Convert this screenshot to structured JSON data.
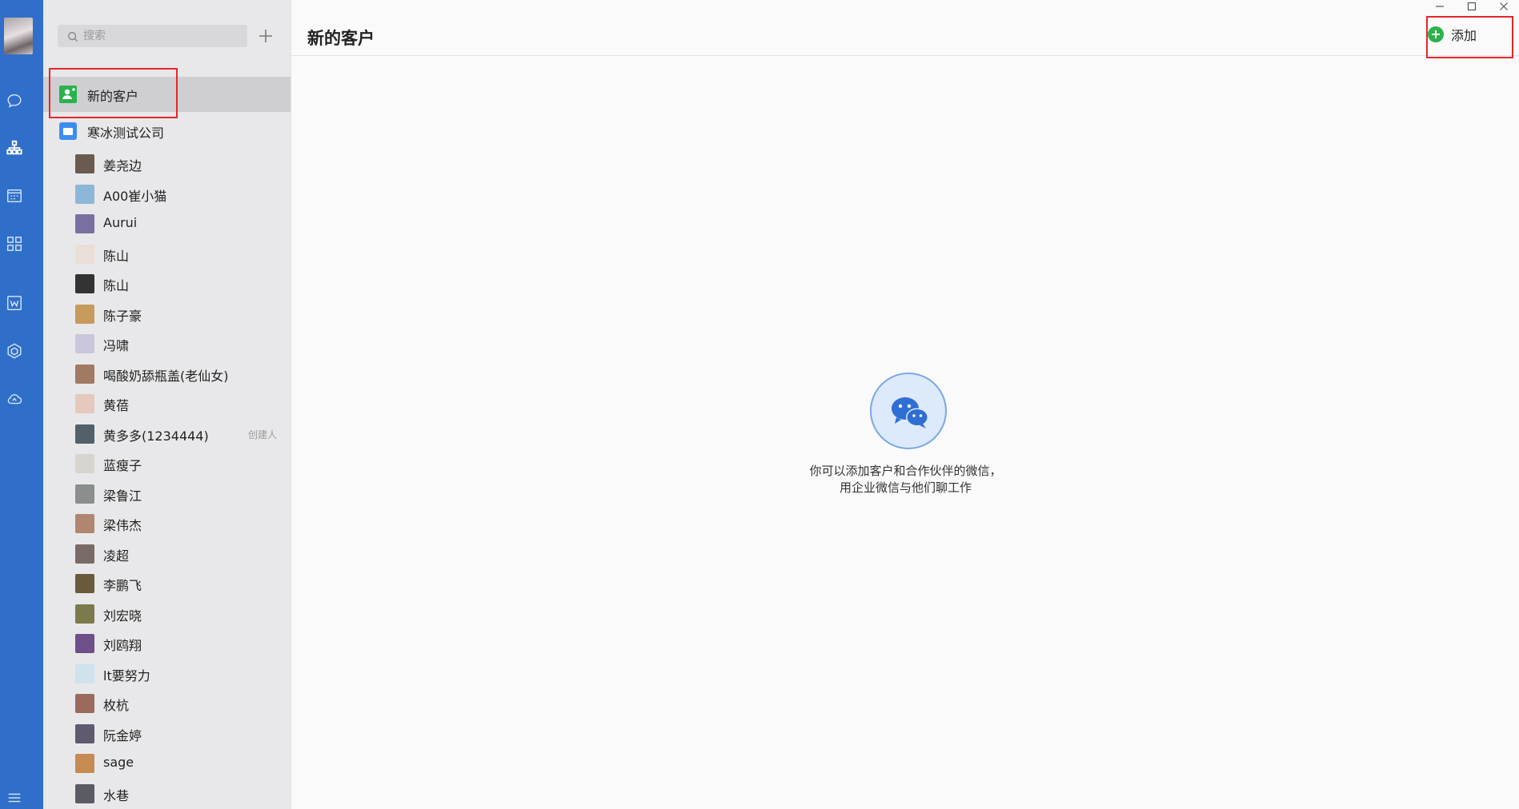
{
  "sidebar": {
    "nav": [
      "messages",
      "contacts",
      "calendar",
      "workbench",
      "documents",
      "apps",
      "cloud-drive",
      "menu"
    ],
    "active": "contacts"
  },
  "contacts_panel": {
    "search": {
      "placeholder": "搜索",
      "value": ""
    },
    "new_customer_label": "新的客户",
    "company_label": "寒冰测试公司",
    "members": [
      {
        "name": "姜尧边",
        "tag": ""
      },
      {
        "name": "A00崔小猫",
        "tag": ""
      },
      {
        "name": "Aurui",
        "tag": ""
      },
      {
        "name": "陈山",
        "tag": ""
      },
      {
        "name": "陈山",
        "tag": ""
      },
      {
        "name": "陈子豪",
        "tag": ""
      },
      {
        "name": "冯啸",
        "tag": ""
      },
      {
        "name": "喝酸奶舔瓶盖(老仙女)",
        "tag": ""
      },
      {
        "name": "黄蓓",
        "tag": ""
      },
      {
        "name": "黄多多(1234444)",
        "tag": "创建人"
      },
      {
        "name": "蓝瘦子",
        "tag": ""
      },
      {
        "name": "梁鲁江",
        "tag": ""
      },
      {
        "name": "梁伟杰",
        "tag": ""
      },
      {
        "name": "凌超",
        "tag": ""
      },
      {
        "name": "李鹏飞",
        "tag": ""
      },
      {
        "name": "刘宏晓",
        "tag": ""
      },
      {
        "name": "刘鸥翔",
        "tag": ""
      },
      {
        "name": "lt要努力",
        "tag": ""
      },
      {
        "name": "枚杭",
        "tag": ""
      },
      {
        "name": "阮金婷",
        "tag": ""
      },
      {
        "name": "sage",
        "tag": ""
      },
      {
        "name": "水巷",
        "tag": ""
      }
    ]
  },
  "main": {
    "title": "新的客户",
    "add_label": "添加",
    "empty_line1": "你可以添加客户和合作伙伴的微信，",
    "empty_line2": "用企业微信与他们聊工作"
  },
  "colors": {
    "nav_bg": "#2f6fc9",
    "green_accent": "#2bb24c",
    "highlight_red": "#e5262b",
    "folder_blue": "#3d8cf0"
  }
}
